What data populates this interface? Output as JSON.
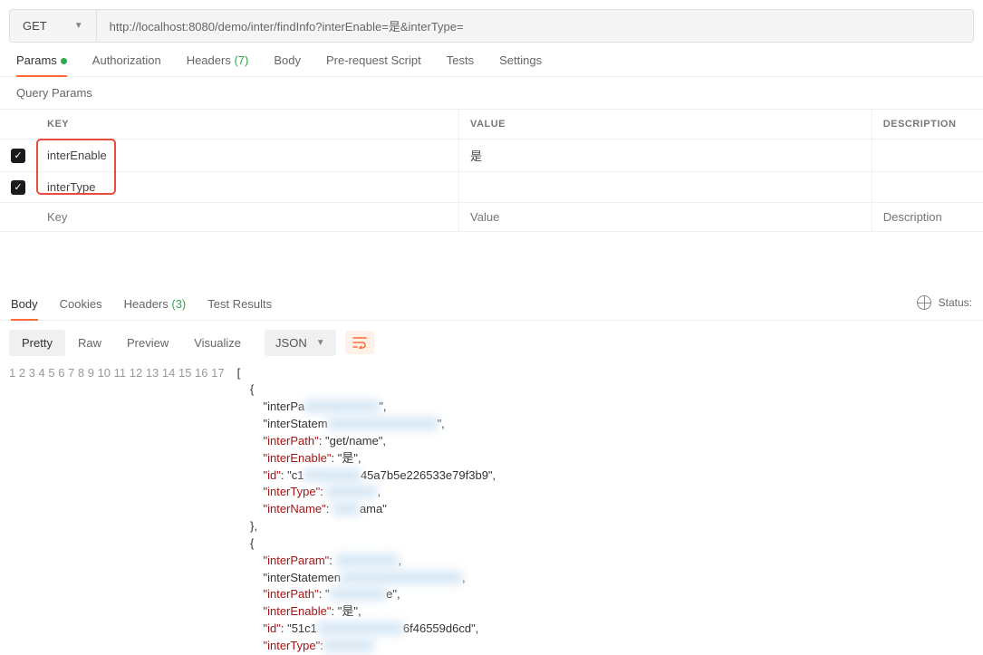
{
  "request": {
    "method": "GET",
    "url": "http://localhost:8080/demo/inter/findInfo?interEnable=是&interType="
  },
  "reqTabs": {
    "params": "Params",
    "auth": "Authorization",
    "headers": "Headers",
    "headersCount": "(7)",
    "body": "Body",
    "prerequest": "Pre-request Script",
    "tests": "Tests",
    "settings": "Settings"
  },
  "sectionTitle": "Query Params",
  "paramsTable": {
    "headers": {
      "key": "KEY",
      "value": "VALUE",
      "desc": "DESCRIPTION"
    },
    "rows": [
      {
        "enabled": true,
        "key": "interEnable",
        "value": "是",
        "desc": ""
      },
      {
        "enabled": true,
        "key": "interType",
        "value": "",
        "desc": ""
      }
    ],
    "placeholders": {
      "key": "Key",
      "value": "Value",
      "desc": "Description"
    }
  },
  "respTabs": {
    "body": "Body",
    "cookies": "Cookies",
    "headers": "Headers",
    "headersCount": "(3)",
    "testResults": "Test Results"
  },
  "statusLabel": "Status:",
  "viewBar": {
    "pretty": "Pretty",
    "raw": "Raw",
    "preview": "Preview",
    "visualize": "Visualize",
    "format": "JSON"
  },
  "code": {
    "lines": [
      "[",
      "    {",
      "        \"interPa████████████\",",
      "        \"interStatem██████████████████\",",
      "        \"interPath\": \"get/name\",",
      "        \"interEnable\": \"是\",",
      "        \"id\": \"c1█████████45a7b5e226533e79f3b9\",",
      "        \"interType\": ████████,",
      "        \"interName\": ████ama\"",
      "    },",
      "    {",
      "        \"interParam\": ██████████,",
      "        \"interStatemen████████████████████,",
      "        \"interPath\": \"█████████e\",",
      "        \"interEnable\": \"是\",",
      "        \"id\": \"51c1██████████████6f46559d6cd\",",
      "        \"interType\":████████"
    ]
  }
}
